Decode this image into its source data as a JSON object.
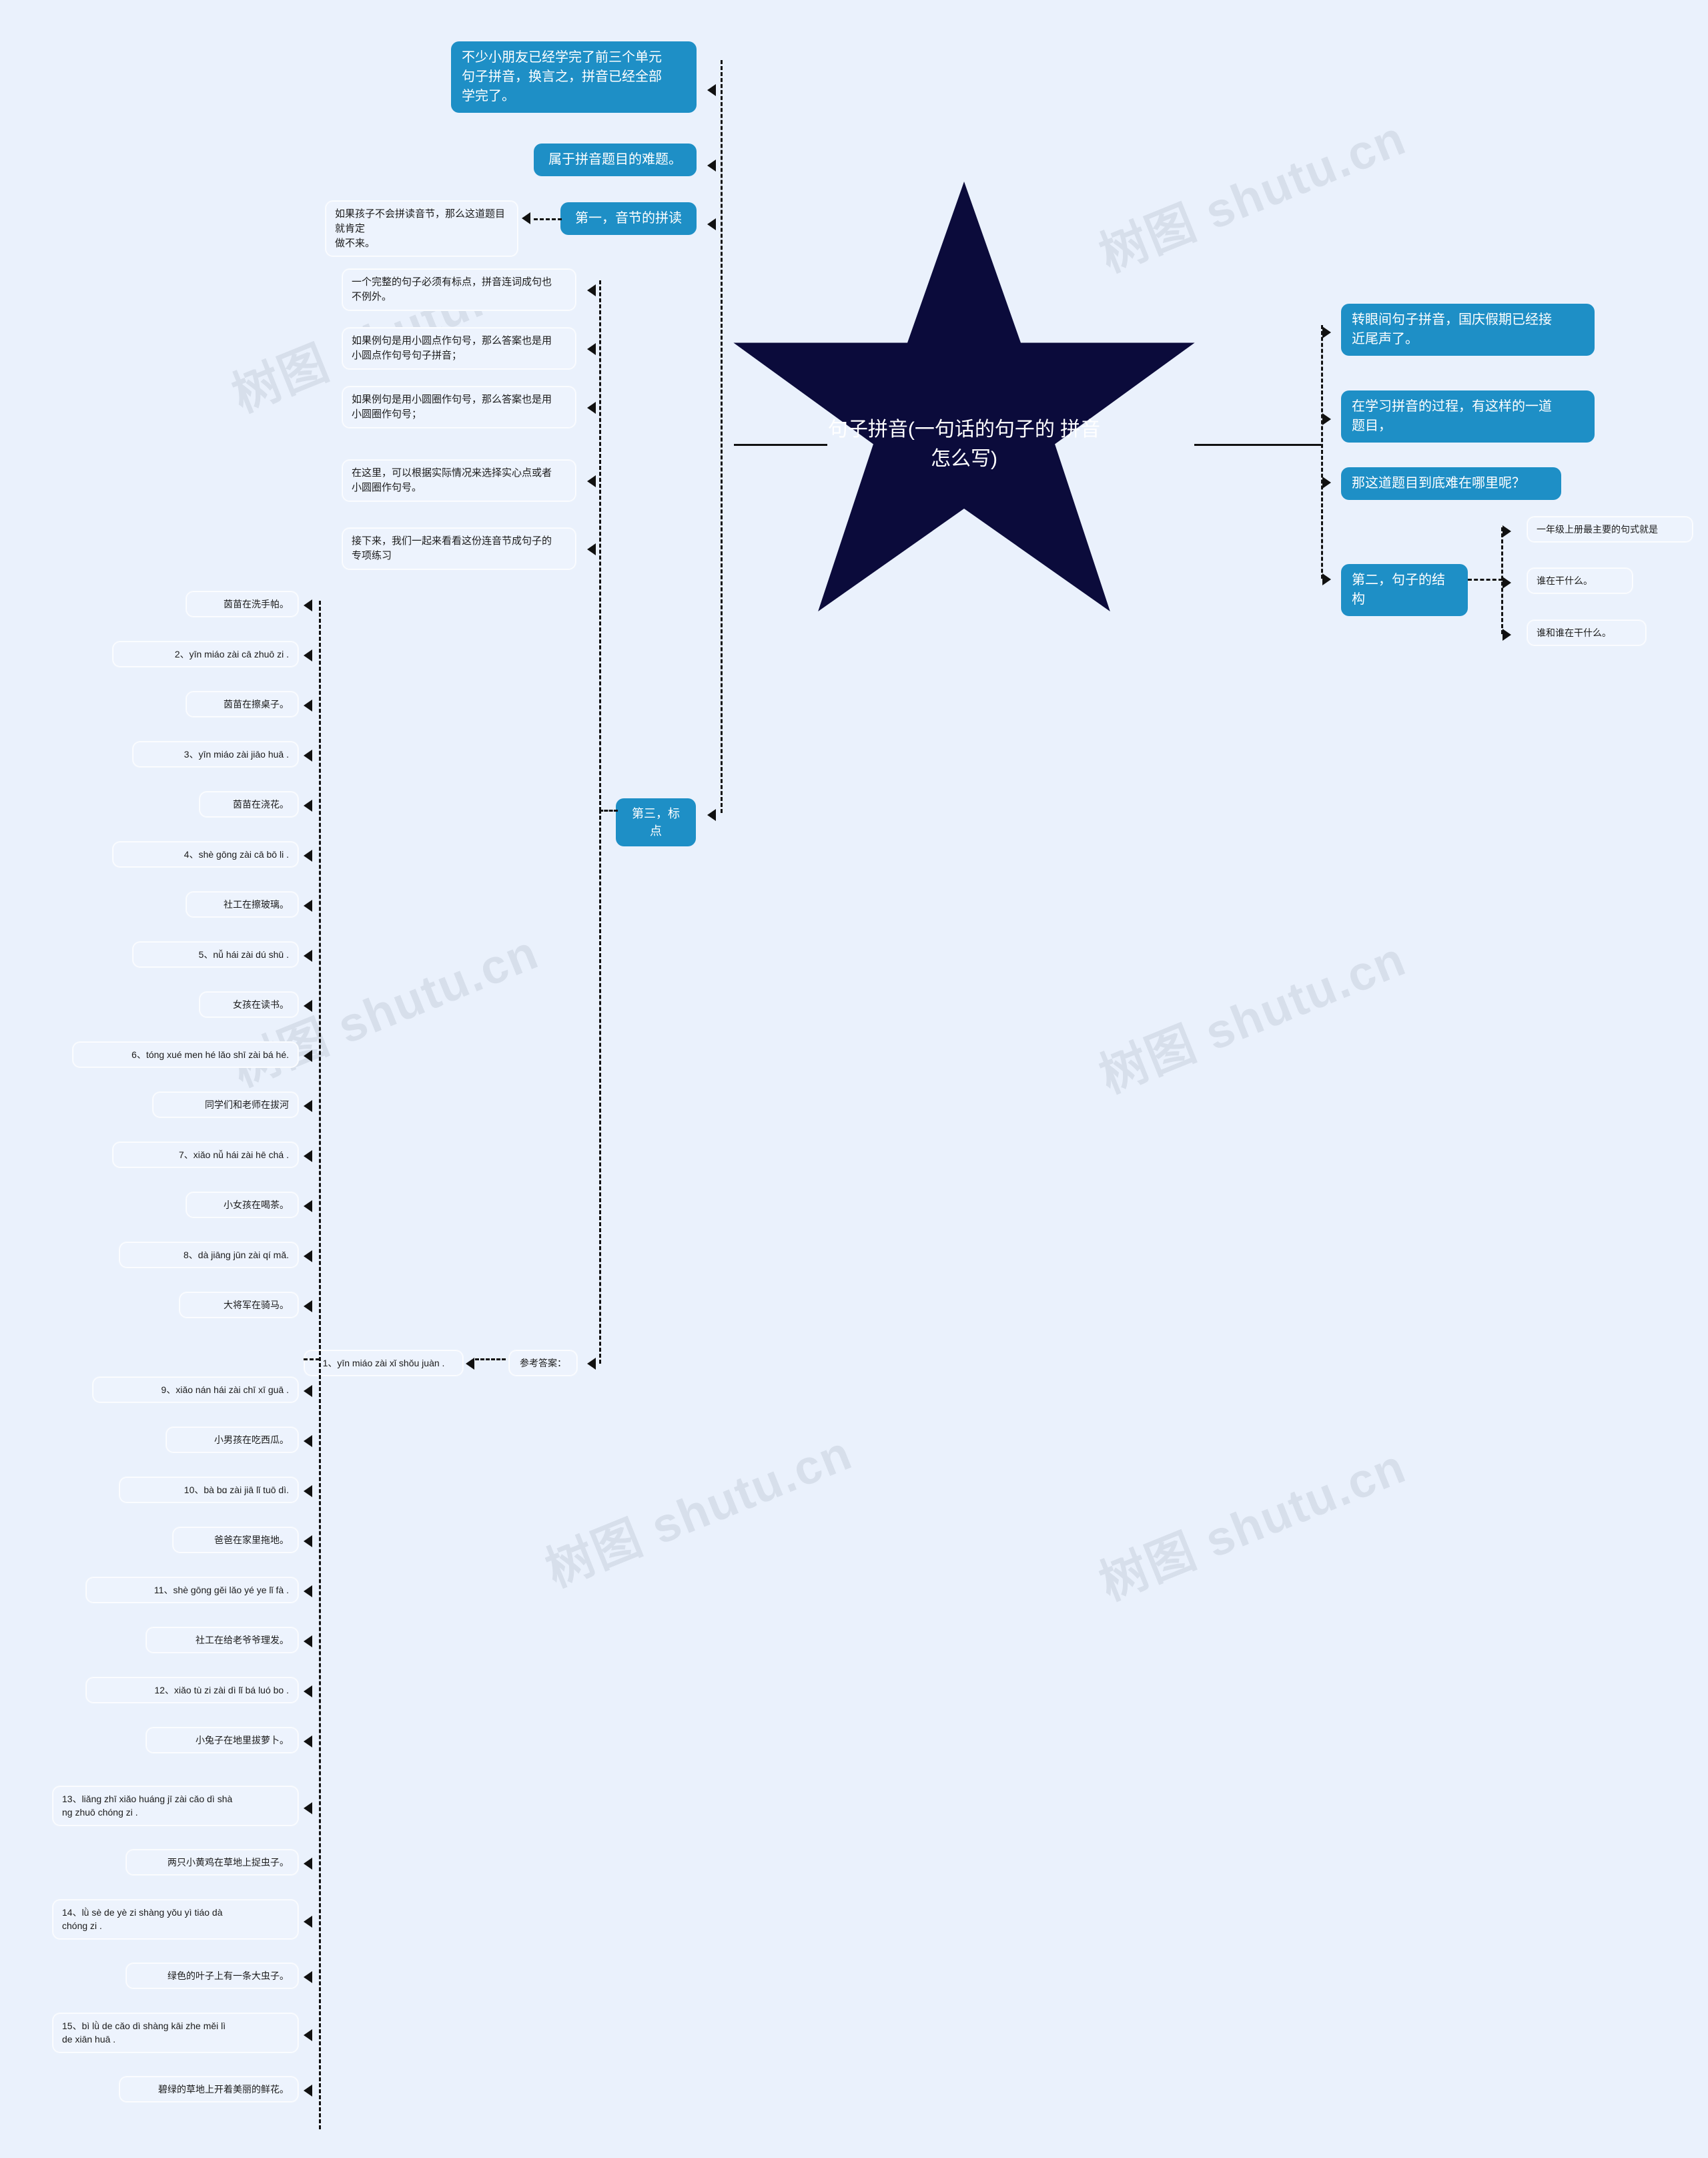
{
  "root": {
    "title": "句子拼音(一句话的句子的\n拼音怎么写)"
  },
  "watermarks": [
    "树图 shutu.cn",
    "树图 shutu.cn",
    "树图 shutu.cn",
    "树图 shutu.cn",
    "树图 shutu.cn",
    "树图 shutu.cn"
  ],
  "right_branch": {
    "items": [
      {
        "label": "转眼间句子拼音，国庆假期已经接\n近尾声了。"
      },
      {
        "label": "在学习拼音的过程，有这样的一道\n题目，"
      },
      {
        "label": "那这道题目到底难在哪里呢？"
      },
      {
        "label": "第二，句子的结构"
      }
    ],
    "structure_children": [
      {
        "label": "一年级上册最主要的句式就是"
      },
      {
        "label": "谁在干什么。"
      },
      {
        "label": "谁和谁在干什么。"
      }
    ]
  },
  "left_branch": {
    "top_items": [
      {
        "label": "不少小朋友已经学完了前三个单元\n句子拼音，换言之，拼音已经全部\n学完了。"
      },
      {
        "label": "属于拼音题目的难题。"
      },
      {
        "label": "第一，音节的拼读"
      }
    ],
    "first_child": {
      "label": "如果孩子不会拼读音节，那么这道题目就肯定\n做不来。"
    },
    "punctuation_node": {
      "label": "第三，标点"
    },
    "punctuation_children": [
      {
        "label": "一个完整的句子必须有标点，拼音连词成句也\n不例外。"
      },
      {
        "label": "如果例句是用小圆点作句号，那么答案也是用\n小圆点作句号句子拼音；"
      },
      {
        "label": "如果例句是用小圆圈作句号，那么答案也是用\n小圆圈作句号；"
      },
      {
        "label": "在这里，可以根据实际情况来选择实心点或者\n小圆圈作句号。"
      },
      {
        "label": "接下来，我们一起来看看这份连音节成句子的\n专项练习"
      }
    ],
    "answer_node": {
      "label": "参考答案："
    },
    "answer_first": {
      "label": "1、yīn miáo zài xǐ shǒu juàn ."
    },
    "answer_items": [
      {
        "label": "茵苗在洗手帕。"
      },
      {
        "label": "2、yīn miáo zài cā zhuō zi ."
      },
      {
        "label": "茵苗在擦桌子。"
      },
      {
        "label": "3、yīn miáo zài jiāo huā ."
      },
      {
        "label": "茵苗在浇花。"
      },
      {
        "label": "4、shè gōng zài cā bō li ."
      },
      {
        "label": "社工在擦玻璃。"
      },
      {
        "label": "5、nǚ hái zài dú shū ."
      },
      {
        "label": "女孩在读书。"
      },
      {
        "label": "6、tóng xué men hé lǎo shī zài bá hé."
      },
      {
        "label": "同学们和老师在拔河"
      },
      {
        "label": "7、xiǎo nǚ hái zài hē chá ."
      },
      {
        "label": "小女孩在喝茶。"
      },
      {
        "label": "8、dà jiāng jūn zài qí mǎ."
      },
      {
        "label": "大将军在骑马。"
      },
      {
        "label": "9、xiǎo nán hái zài chī xī guā ."
      },
      {
        "label": "小男孩在吃西瓜。"
      },
      {
        "label": "10、bà bɑ zài jiā lǐ tuō dì."
      },
      {
        "label": "爸爸在家里拖地。"
      },
      {
        "label": "11、shè gōng gěi lǎo yé ye lǐ fà ."
      },
      {
        "label": "社工在给老爷爷理发。"
      },
      {
        "label": "12、xiǎo tù zi zài dì lǐ bá luó bo ."
      },
      {
        "label": "小兔子在地里拔萝卜。"
      },
      {
        "label": "13、liǎng zhī xiǎo huáng jī zài cǎo dì shà\nng zhuō chóng zi ."
      },
      {
        "label": "两只小黄鸡在草地上捉虫子。"
      },
      {
        "label": "14、lǜ sè de yè zi shàng yǒu yì tiáo dà\nchóng zi ."
      },
      {
        "label": "绿色的叶子上有一条大虫子。"
      },
      {
        "label": "15、bì lǜ de cǎo dì shàng kāi zhe měi lì\nde xiān huā ."
      },
      {
        "label": "碧绿的草地上开着美丽的鲜花。"
      }
    ]
  },
  "colors": {
    "background": "#eaf1fc",
    "accent_blue": "#1e8fc6",
    "star_fill": "#0b0b3b",
    "node_bg": "#edf3fd",
    "line": "#111111",
    "text_dark": "#1b1b1b",
    "text_light": "#ffffff"
  }
}
